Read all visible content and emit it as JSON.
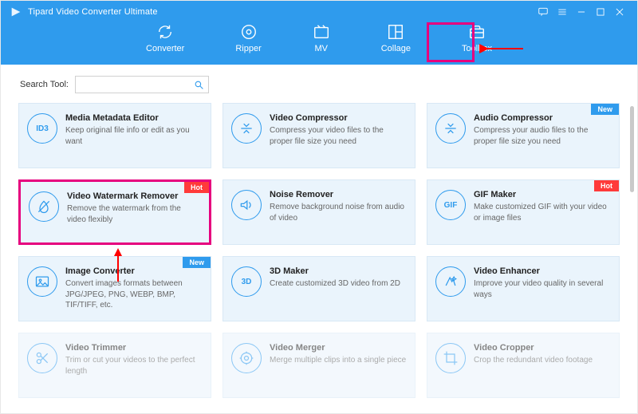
{
  "app_title": "Tipard Video Converter Ultimate",
  "tabs": {
    "converter": "Converter",
    "ripper": "Ripper",
    "mv": "MV",
    "collage": "Collage",
    "toolbox": "Toolbox"
  },
  "search_label": "Search Tool:",
  "search_value": "",
  "badges": {
    "hot": "Hot",
    "new": "New"
  },
  "tools": {
    "metadata": {
      "title": "Media Metadata Editor",
      "desc": "Keep original file info or edit as you want"
    },
    "vcompress": {
      "title": "Video Compressor",
      "desc": "Compress your video files to the proper file size you need"
    },
    "acompress": {
      "title": "Audio Compressor",
      "desc": "Compress your audio files to the proper file size you need"
    },
    "watermark": {
      "title": "Video Watermark Remover",
      "desc": "Remove the watermark from the video flexibly"
    },
    "noise": {
      "title": "Noise Remover",
      "desc": "Remove background noise from audio of video"
    },
    "gif": {
      "title": "GIF Maker",
      "desc": "Make customized GIF with your video or image files"
    },
    "imgconv": {
      "title": "Image Converter",
      "desc": "Convert images formats between JPG/JPEG, PNG, WEBP, BMP, TIF/TIFF, etc."
    },
    "threed": {
      "title": "3D Maker",
      "desc": "Create customized 3D video from 2D"
    },
    "enhancer": {
      "title": "Video Enhancer",
      "desc": "Improve your video quality in several ways"
    },
    "trimmer": {
      "title": "Video Trimmer",
      "desc": "Trim or cut your videos to the perfect length"
    },
    "merger": {
      "title": "Video Merger",
      "desc": "Merge multiple clips into a single piece"
    },
    "cropper": {
      "title": "Video Cropper",
      "desc": "Crop the redundant video footage"
    }
  },
  "icons": {
    "metadata_text": "ID3",
    "gif_text": "GIF",
    "threed_text": "3D"
  }
}
